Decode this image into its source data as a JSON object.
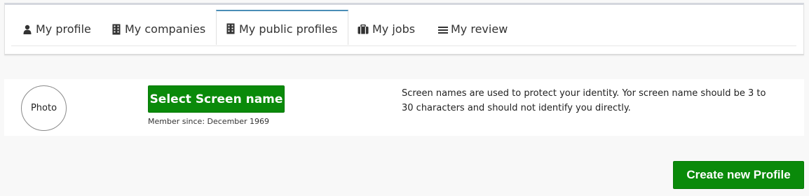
{
  "tabs": [
    {
      "label": "My profile",
      "icon": "user-icon"
    },
    {
      "label": "My companies",
      "icon": "building-icon"
    },
    {
      "label": "My public profiles",
      "icon": "building-icon",
      "active": true
    },
    {
      "label": "My jobs",
      "icon": "briefcase-icon"
    },
    {
      "label": "My review",
      "icon": "list-icon"
    }
  ],
  "profile": {
    "photo_label": "Photo",
    "select_screen_name_label": "Select Screen name",
    "member_since": "Member since: December 1969",
    "help_text": "Screen names are used to protect your identity. Yor screen name should be 3 to 30 characters and should not identify you directly."
  },
  "actions": {
    "create_profile_label": "Create new Profile"
  },
  "colors": {
    "primary_green": "#0a8a0a",
    "active_tab_accent": "#4a8db7",
    "page_background": "#f8f8f8"
  }
}
